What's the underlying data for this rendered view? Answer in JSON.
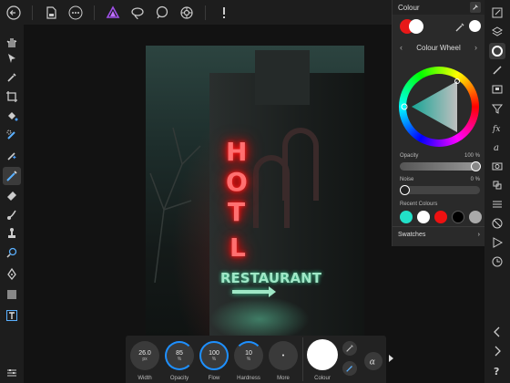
{
  "panel": {
    "title": "Colour",
    "mode": "Colour Wheel",
    "opacity_label": "Opacity",
    "opacity_value": "100 %",
    "noise_label": "Noise",
    "noise_value": "0 %",
    "recent_label": "Recent Colours",
    "recent_colors": [
      "#22e0c8",
      "#ffffff",
      "#ee1111",
      "#000000",
      "#aaaaaa"
    ],
    "swatches_label": "Swatches",
    "primary_color": "#e81818",
    "secondary_color": "#ffffff"
  },
  "canvas": {
    "sign_letters": [
      "H",
      "O",
      "T",
      "L"
    ],
    "restaurant_text": "RESTAURANT"
  },
  "brush": {
    "width_value": "26.0",
    "width_unit": "px",
    "width_label": "Width",
    "opacity_value": "85",
    "opacity_unit": "%",
    "opacity_label": "Opacity",
    "flow_value": "100",
    "flow_unit": "%",
    "flow_label": "Flow",
    "hardness_value": "10",
    "hardness_unit": "%",
    "hardness_label": "Hardness",
    "more_label": "More",
    "more_value": "•",
    "colour_label": "Colour"
  }
}
